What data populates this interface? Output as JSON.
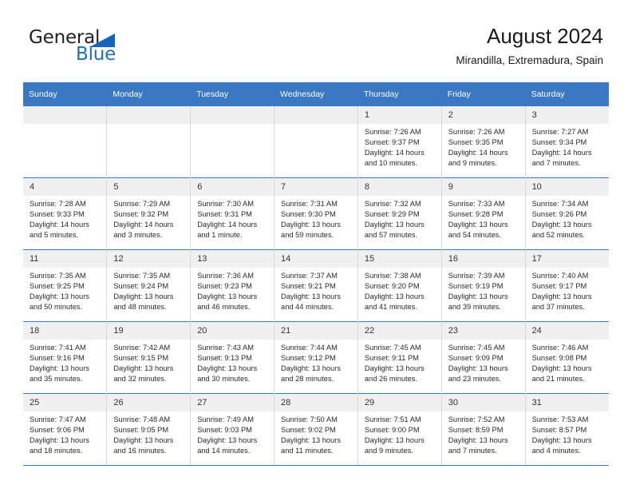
{
  "brand": {
    "name_part1": "General",
    "name_part2": "Blue",
    "triangle_color": "#1565c0",
    "blue_color": "#1c71bd"
  },
  "header": {
    "title": "August 2024",
    "subtitle": "Mirandilla, Extremadura, Spain"
  },
  "theme": {
    "header_row_bg": "#3b78c3",
    "header_row_text": "#ffffff",
    "day_number_bg": "#f0f0f0",
    "cell_bg": "#ffffff",
    "grid_line": "#3b78c3"
  },
  "weekdays": [
    "Sunday",
    "Monday",
    "Tuesday",
    "Wednesday",
    "Thursday",
    "Friday",
    "Saturday"
  ],
  "weeks": [
    [
      {
        "day": "",
        "empty": true,
        "lines": []
      },
      {
        "day": "",
        "empty": true,
        "lines": []
      },
      {
        "day": "",
        "empty": true,
        "lines": []
      },
      {
        "day": "",
        "empty": true,
        "lines": []
      },
      {
        "day": "1",
        "empty": false,
        "lines": [
          "Sunrise: 7:26 AM",
          "Sunset: 9:37 PM",
          "Daylight: 14 hours",
          "and 10 minutes."
        ]
      },
      {
        "day": "2",
        "empty": false,
        "lines": [
          "Sunrise: 7:26 AM",
          "Sunset: 9:35 PM",
          "Daylight: 14 hours",
          "and 9 minutes."
        ]
      },
      {
        "day": "3",
        "empty": false,
        "lines": [
          "Sunrise: 7:27 AM",
          "Sunset: 9:34 PM",
          "Daylight: 14 hours",
          "and 7 minutes."
        ]
      }
    ],
    [
      {
        "day": "4",
        "empty": false,
        "lines": [
          "Sunrise: 7:28 AM",
          "Sunset: 9:33 PM",
          "Daylight: 14 hours",
          "and 5 minutes."
        ]
      },
      {
        "day": "5",
        "empty": false,
        "lines": [
          "Sunrise: 7:29 AM",
          "Sunset: 9:32 PM",
          "Daylight: 14 hours",
          "and 3 minutes."
        ]
      },
      {
        "day": "6",
        "empty": false,
        "lines": [
          "Sunrise: 7:30 AM",
          "Sunset: 9:31 PM",
          "Daylight: 14 hours",
          "and 1 minute."
        ]
      },
      {
        "day": "7",
        "empty": false,
        "lines": [
          "Sunrise: 7:31 AM",
          "Sunset: 9:30 PM",
          "Daylight: 13 hours",
          "and 59 minutes."
        ]
      },
      {
        "day": "8",
        "empty": false,
        "lines": [
          "Sunrise: 7:32 AM",
          "Sunset: 9:29 PM",
          "Daylight: 13 hours",
          "and 57 minutes."
        ]
      },
      {
        "day": "9",
        "empty": false,
        "lines": [
          "Sunrise: 7:33 AM",
          "Sunset: 9:28 PM",
          "Daylight: 13 hours",
          "and 54 minutes."
        ]
      },
      {
        "day": "10",
        "empty": false,
        "lines": [
          "Sunrise: 7:34 AM",
          "Sunset: 9:26 PM",
          "Daylight: 13 hours",
          "and 52 minutes."
        ]
      }
    ],
    [
      {
        "day": "11",
        "empty": false,
        "lines": [
          "Sunrise: 7:35 AM",
          "Sunset: 9:25 PM",
          "Daylight: 13 hours",
          "and 50 minutes."
        ]
      },
      {
        "day": "12",
        "empty": false,
        "lines": [
          "Sunrise: 7:35 AM",
          "Sunset: 9:24 PM",
          "Daylight: 13 hours",
          "and 48 minutes."
        ]
      },
      {
        "day": "13",
        "empty": false,
        "lines": [
          "Sunrise: 7:36 AM",
          "Sunset: 9:23 PM",
          "Daylight: 13 hours",
          "and 46 minutes."
        ]
      },
      {
        "day": "14",
        "empty": false,
        "lines": [
          "Sunrise: 7:37 AM",
          "Sunset: 9:21 PM",
          "Daylight: 13 hours",
          "and 44 minutes."
        ]
      },
      {
        "day": "15",
        "empty": false,
        "lines": [
          "Sunrise: 7:38 AM",
          "Sunset: 9:20 PM",
          "Daylight: 13 hours",
          "and 41 minutes."
        ]
      },
      {
        "day": "16",
        "empty": false,
        "lines": [
          "Sunrise: 7:39 AM",
          "Sunset: 9:19 PM",
          "Daylight: 13 hours",
          "and 39 minutes."
        ]
      },
      {
        "day": "17",
        "empty": false,
        "lines": [
          "Sunrise: 7:40 AM",
          "Sunset: 9:17 PM",
          "Daylight: 13 hours",
          "and 37 minutes."
        ]
      }
    ],
    [
      {
        "day": "18",
        "empty": false,
        "lines": [
          "Sunrise: 7:41 AM",
          "Sunset: 9:16 PM",
          "Daylight: 13 hours",
          "and 35 minutes."
        ]
      },
      {
        "day": "19",
        "empty": false,
        "lines": [
          "Sunrise: 7:42 AM",
          "Sunset: 9:15 PM",
          "Daylight: 13 hours",
          "and 32 minutes."
        ]
      },
      {
        "day": "20",
        "empty": false,
        "lines": [
          "Sunrise: 7:43 AM",
          "Sunset: 9:13 PM",
          "Daylight: 13 hours",
          "and 30 minutes."
        ]
      },
      {
        "day": "21",
        "empty": false,
        "lines": [
          "Sunrise: 7:44 AM",
          "Sunset: 9:12 PM",
          "Daylight: 13 hours",
          "and 28 minutes."
        ]
      },
      {
        "day": "22",
        "empty": false,
        "lines": [
          "Sunrise: 7:45 AM",
          "Sunset: 9:11 PM",
          "Daylight: 13 hours",
          "and 26 minutes."
        ]
      },
      {
        "day": "23",
        "empty": false,
        "lines": [
          "Sunrise: 7:45 AM",
          "Sunset: 9:09 PM",
          "Daylight: 13 hours",
          "and 23 minutes."
        ]
      },
      {
        "day": "24",
        "empty": false,
        "lines": [
          "Sunrise: 7:46 AM",
          "Sunset: 9:08 PM",
          "Daylight: 13 hours",
          "and 21 minutes."
        ]
      }
    ],
    [
      {
        "day": "25",
        "empty": false,
        "lines": [
          "Sunrise: 7:47 AM",
          "Sunset: 9:06 PM",
          "Daylight: 13 hours",
          "and 18 minutes."
        ]
      },
      {
        "day": "26",
        "empty": false,
        "lines": [
          "Sunrise: 7:48 AM",
          "Sunset: 9:05 PM",
          "Daylight: 13 hours",
          "and 16 minutes."
        ]
      },
      {
        "day": "27",
        "empty": false,
        "lines": [
          "Sunrise: 7:49 AM",
          "Sunset: 9:03 PM",
          "Daylight: 13 hours",
          "and 14 minutes."
        ]
      },
      {
        "day": "28",
        "empty": false,
        "lines": [
          "Sunrise: 7:50 AM",
          "Sunset: 9:02 PM",
          "Daylight: 13 hours",
          "and 11 minutes."
        ]
      },
      {
        "day": "29",
        "empty": false,
        "lines": [
          "Sunrise: 7:51 AM",
          "Sunset: 9:00 PM",
          "Daylight: 13 hours",
          "and 9 minutes."
        ]
      },
      {
        "day": "30",
        "empty": false,
        "lines": [
          "Sunrise: 7:52 AM",
          "Sunset: 8:59 PM",
          "Daylight: 13 hours",
          "and 7 minutes."
        ]
      },
      {
        "day": "31",
        "empty": false,
        "lines": [
          "Sunrise: 7:53 AM",
          "Sunset: 8:57 PM",
          "Daylight: 13 hours",
          "and 4 minutes."
        ]
      }
    ]
  ]
}
